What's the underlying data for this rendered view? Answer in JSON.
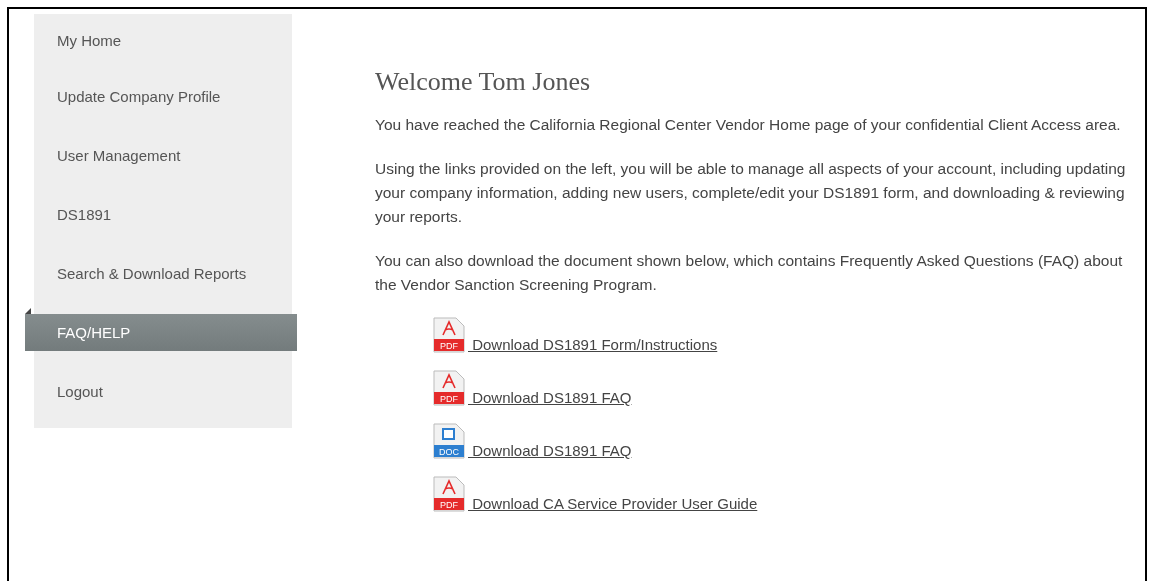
{
  "sidebar": {
    "items": [
      {
        "label": "My Home",
        "selected": false
      },
      {
        "label": "Update Company Profile",
        "selected": false
      },
      {
        "label": "User Management",
        "selected": false
      },
      {
        "label": "DS1891",
        "selected": false
      },
      {
        "label": "Search & Download Reports",
        "selected": false
      },
      {
        "label": "FAQ/HELP",
        "selected": true
      },
      {
        "label": "Logout",
        "selected": false
      }
    ]
  },
  "content": {
    "title": "Welcome Tom Jones",
    "paragraphs": [
      "You have reached the California Regional Center Vendor Home page of your confidential Client Access area.",
      "Using the links provided on the left, you will be able to manage all aspects of your account, including updating your company information, adding new users, complete/edit your DS1891 form, and downloading & reviewing your reports.",
      "You can also download the document shown below, which contains Frequently Asked Questions (FAQ) about the Vendor Sanction Screening Program."
    ],
    "downloads": [
      {
        "kind": "pdf",
        "badge": "PDF",
        "label": " Download DS1891 Form/Instructions"
      },
      {
        "kind": "pdf",
        "badge": "PDF",
        "label": " Download DS1891 FAQ"
      },
      {
        "kind": "doc",
        "badge": "DOC",
        "label": " Download DS1891 FAQ"
      },
      {
        "kind": "pdf",
        "badge": "PDF",
        "label": " Download CA Service Provider User Guide"
      }
    ]
  }
}
